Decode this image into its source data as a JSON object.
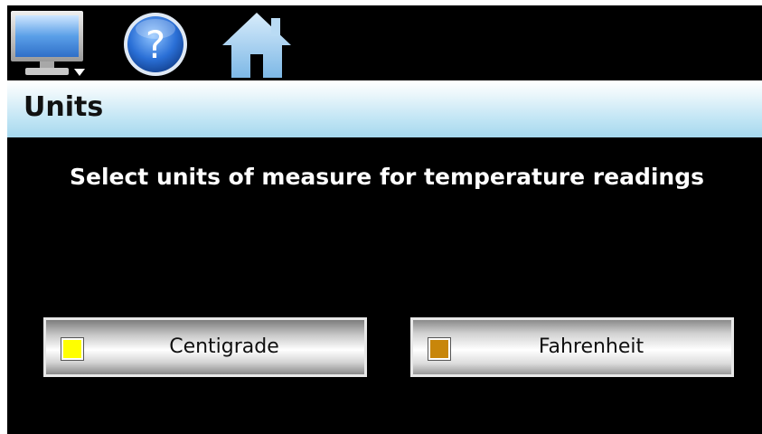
{
  "toolbar": {
    "icons": [
      "monitor-icon",
      "help-icon",
      "home-icon"
    ],
    "help_glyph": "?"
  },
  "header": {
    "title": "Units",
    "title_bar_color": "#bfe4f4"
  },
  "main": {
    "prompt": "Select units of measure for temperature readings",
    "options": [
      {
        "label": "Centigrade",
        "indicator_color": "#ffff00",
        "selected": false
      },
      {
        "label": "Fahrenheit",
        "indicator_color": "#c8860a",
        "selected": true
      }
    ]
  },
  "colors": {
    "background": "#000000",
    "accent": "#1f6ad0"
  }
}
